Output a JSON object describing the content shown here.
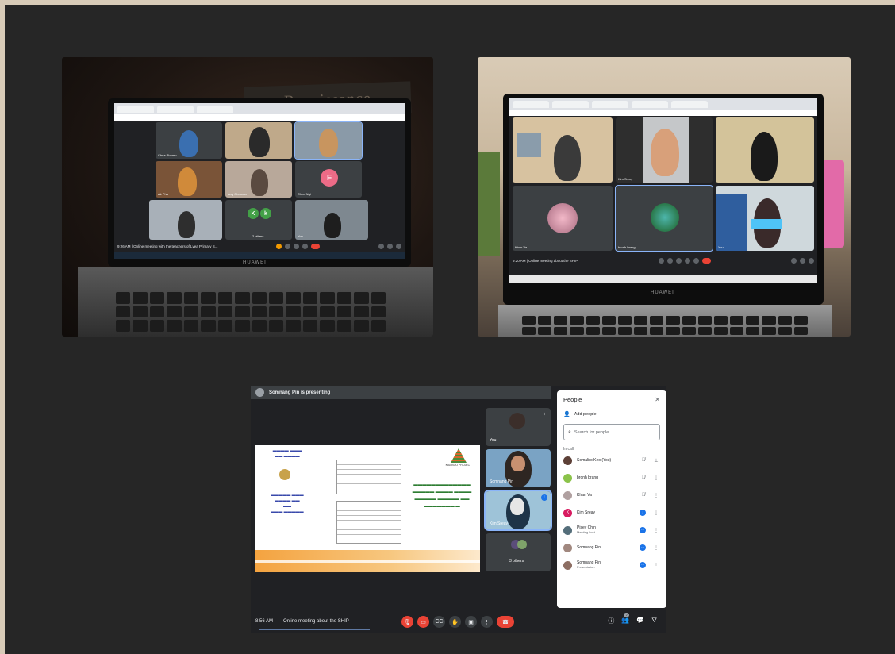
{
  "left_photo": {
    "wall_sign": "Renaissance",
    "laptop_brand": "HUAWEI",
    "meeting_info": "9:26 AM | Online meeting with the teachers of Lvea Primary S...",
    "tiles": [
      {
        "name": "Chea Phearo"
      },
      {
        "name": ""
      },
      {
        "name": ""
      },
      {
        "name": "Ak Pha"
      },
      {
        "name": "Ang Chourna"
      },
      {
        "name": "Chea Ngi"
      },
      {
        "name": ""
      },
      {
        "name": "2 others"
      },
      {
        "name": "You"
      }
    ],
    "avatar_letter": "F",
    "avatar_kk": [
      "K",
      "k"
    ]
  },
  "right_photo": {
    "laptop_brand": "HUAWEI",
    "meeting_info": "9:20 AM | Online meeting about the SHIP",
    "tiles": [
      {
        "name": ""
      },
      {
        "name": "Kim Sreay"
      },
      {
        "name": ""
      },
      {
        "name": "Khan Va"
      },
      {
        "name": "bronh brang"
      },
      {
        "name": "You"
      }
    ]
  },
  "meet": {
    "presenting_label": "Somnang Pin is presenting",
    "slide": {
      "logo_label": "KAMBOO PROJECT",
      "main_text": "Khmer title text"
    },
    "side_tiles": [
      {
        "name": "You"
      },
      {
        "name": "Somnang Pin"
      },
      {
        "name": "Kim Sreay"
      },
      {
        "name": "3 others"
      }
    ],
    "people_panel": {
      "title": "People",
      "add_people": "Add people",
      "search_placeholder": "Search for people",
      "in_call": "In call",
      "people": [
        {
          "name": "Somaliro Keo (You)",
          "role": "",
          "initial": "",
          "color": "#5d4037"
        },
        {
          "name": "bronh brang",
          "role": "",
          "initial": "",
          "color": "#8bc34a"
        },
        {
          "name": "Khan Va",
          "role": "",
          "initial": "",
          "color": "#b0a0a0"
        },
        {
          "name": "Kim Sreay",
          "role": "",
          "initial": "K",
          "color": "#d81b60"
        },
        {
          "name": "Pisey Chin",
          "role": "Meeting host",
          "initial": "",
          "color": "#546e7a"
        },
        {
          "name": "Somnang Pin",
          "role": "",
          "initial": "",
          "color": "#a1887f"
        },
        {
          "name": "Somnang Pin",
          "role": "Presentation",
          "initial": "",
          "color": "#8d6e63"
        }
      ]
    },
    "bottom": {
      "time": "8:56 AM",
      "title": "Online meeting about the SHIP",
      "people_count": "7"
    }
  }
}
